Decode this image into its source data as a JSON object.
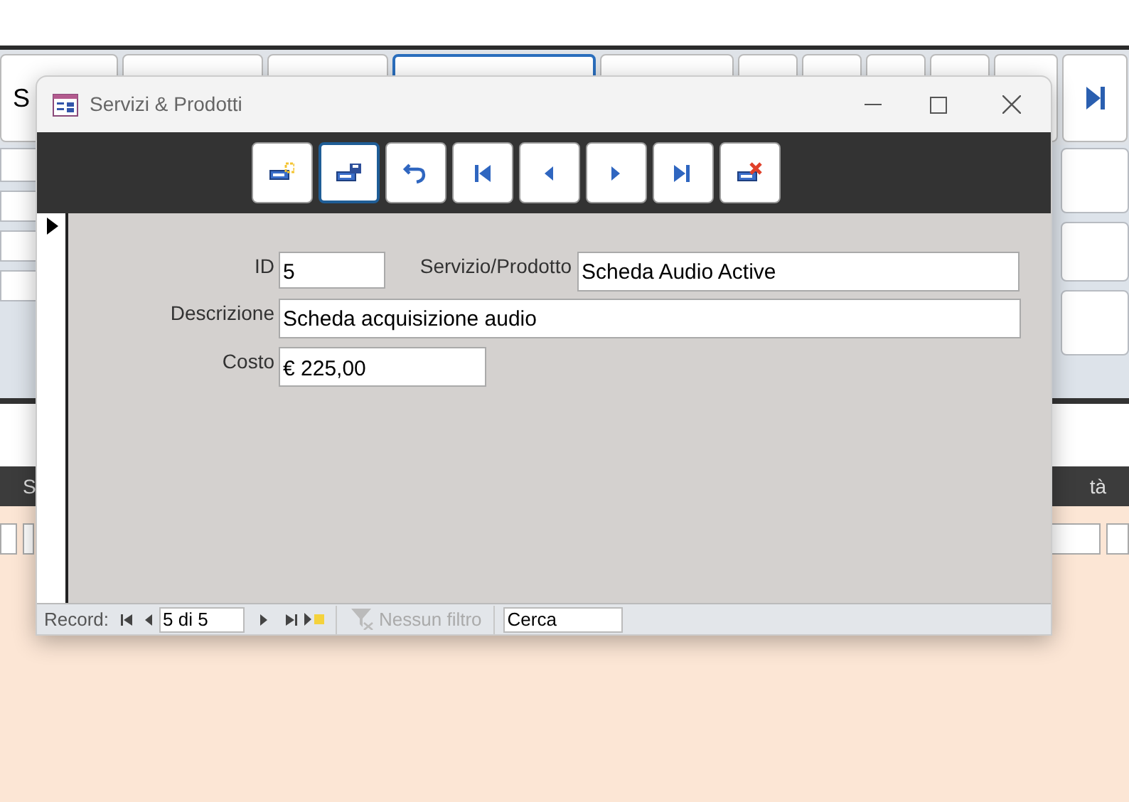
{
  "background_tabs": [
    {
      "label": "S",
      "selected": false
    },
    {
      "selected": false
    },
    {
      "selected": false
    },
    {
      "selected": true
    },
    {
      "selected": false
    },
    {
      "selected": false
    },
    {
      "selected": false
    },
    {
      "selected": false
    },
    {
      "selected": false
    },
    {
      "selected": false
    },
    {
      "kind": "last",
      "selected": false
    }
  ],
  "background_header": {
    "column_1": "S",
    "column_2": "tà"
  },
  "window": {
    "title": "Servizi & Prodotti"
  },
  "toolbar": [
    {
      "kind": "new",
      "focused": false
    },
    {
      "kind": "save",
      "focused": true
    },
    {
      "kind": "undo",
      "focused": false
    },
    {
      "kind": "first",
      "focused": false
    },
    {
      "kind": "prev",
      "focused": false
    },
    {
      "kind": "next",
      "focused": false
    },
    {
      "kind": "last",
      "focused": false
    },
    {
      "kind": "delete",
      "focused": false
    }
  ],
  "form": {
    "id": {
      "label": "ID",
      "value": "5"
    },
    "servizio": {
      "label": "Servizio/Prodotto",
      "value": "Scheda Audio Active"
    },
    "descrizione": {
      "label": "Descrizione",
      "value": "Scheda acquisizione audio"
    },
    "costo": {
      "label": "Costo",
      "value": "€ 225,00"
    }
  },
  "status_bar": {
    "record_label": "Record:",
    "record_value": "5 di 5",
    "filter": {
      "label": "Nessun filtro",
      "disabled": true
    },
    "search": {
      "placeholder": "Cerca"
    }
  }
}
